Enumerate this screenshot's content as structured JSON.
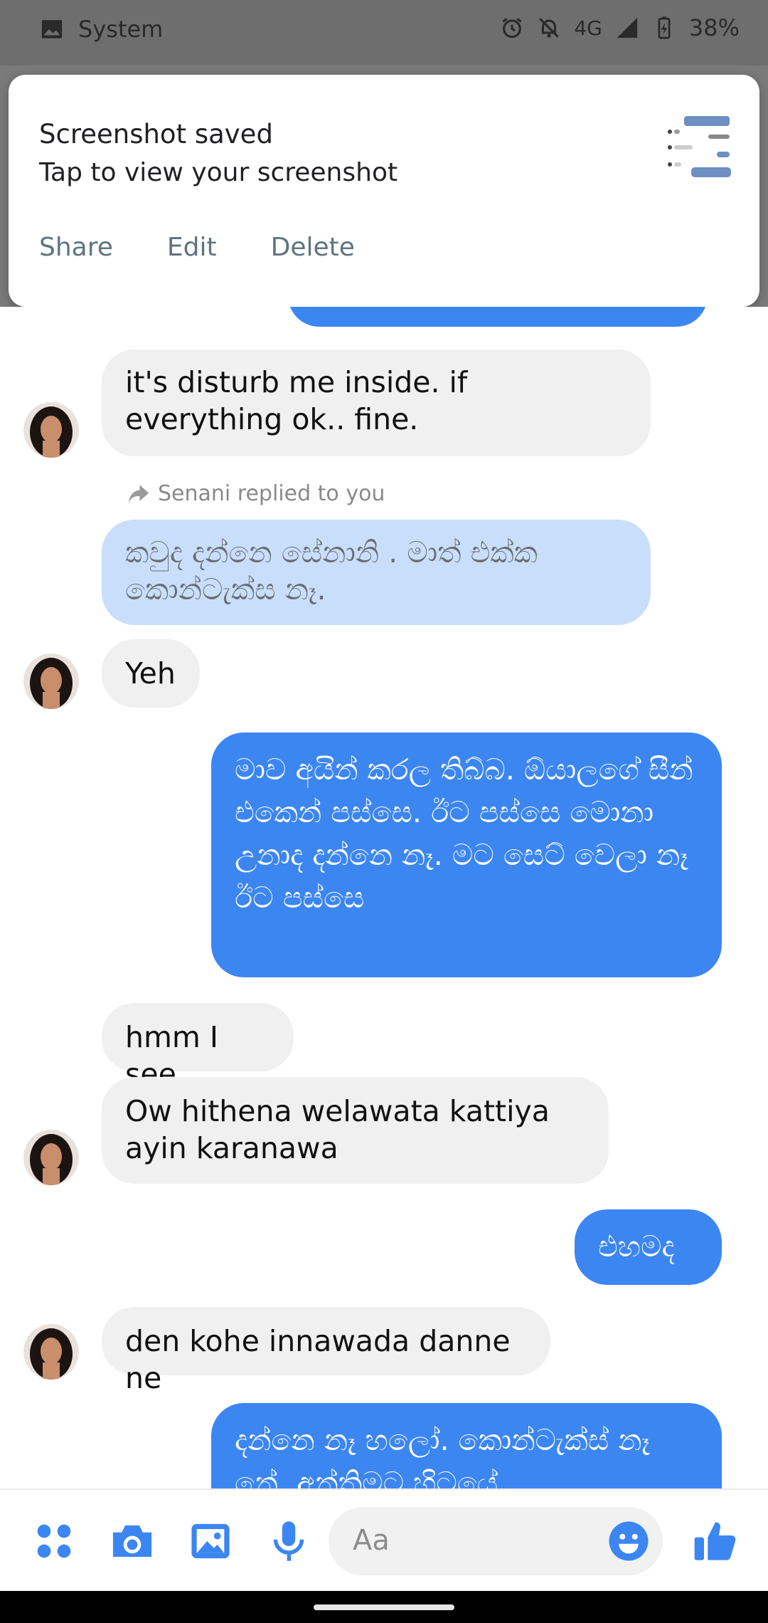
{
  "status_bar": {
    "app_label": "System",
    "network": "4G",
    "battery": "38%"
  },
  "notification": {
    "title": "Screenshot saved",
    "subtitle": "Tap to view your screenshot",
    "actions": [
      "Share",
      "Edit",
      "Delete"
    ]
  },
  "chat": {
    "messages": [
      {
        "from": "them",
        "text": "it's disturb me inside. if everything ok.. fine."
      },
      {
        "reply_indicator": "Senani replied to you"
      },
      {
        "from": "me",
        "quoted": true,
        "text": "කවුද දන්නෙ සේනානි .  මාත් එක්ක කොන්ටැක්ස නෑ."
      },
      {
        "from": "them",
        "text": "Yeh"
      },
      {
        "from": "me",
        "text": "මාව අයින් කරල තිබ්බ. ඕයාලගේ සීන් එකෙන් පස්සෙ. ඊට පස්සෙ මොනා උනාද දන්නෙ නෑ. මට සෙට් වෙලා නෑ ඊට පස්සෙ"
      },
      {
        "from": "them",
        "text": "hmm I see"
      },
      {
        "from": "them",
        "text": "Ow hithena welawata kattiya ayin karanawa"
      },
      {
        "from": "me",
        "text": "එහමද"
      },
      {
        "from": "them",
        "text": "den kohe innawada danne ne"
      },
      {
        "from": "me",
        "text": "දන්නෙ නෑ හලෝ. කොන්ටැක්ස් නෑ නේ. අන්තිමට හිටයේ"
      }
    ]
  },
  "composer": {
    "placeholder": "Aa",
    "icons": [
      "apps-icon",
      "camera-icon",
      "gallery-icon",
      "mic-icon",
      "emoji-icon",
      "like-icon"
    ]
  },
  "colors": {
    "outgoing": "#3c86f2",
    "incoming": "#f0f0f0",
    "quoted": "#c8defb",
    "accent": "#3c86f2"
  }
}
